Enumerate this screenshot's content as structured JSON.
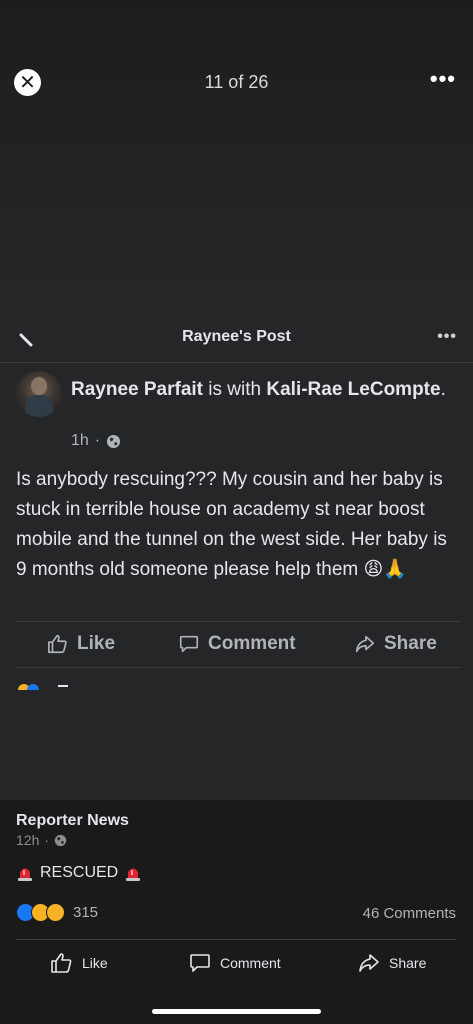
{
  "viewer": {
    "counter": "11 of 26",
    "close_icon": "✕",
    "more_icon": "•••"
  },
  "post_header": {
    "title": "Raynee's Post",
    "more_icon": "•••"
  },
  "post": {
    "author": "Raynee Parfait",
    "with_text": "is with",
    "tagged": "Kali-Rae LeCompte",
    "period": ".",
    "time": "1h",
    "dot": "·",
    "text": "Is anybody rescuing??? My cousin and her baby is stuck in terrible house on academy st near boost mobile and the tunnel on the west side. Her baby is 9 months old someone please help them",
    "emoji": "😩🙏"
  },
  "actions": {
    "like": "Like",
    "comment": "Comment",
    "share": "Share"
  },
  "reporter": {
    "name": "Reporter News",
    "time": "12h",
    "dot": "·",
    "text": "RESCUED",
    "reaction_count": "315",
    "comments": "46 Comments"
  },
  "bottom_actions": {
    "like": "Like",
    "comment": "Comment",
    "share": "Share"
  },
  "colors": {
    "background": "#252628",
    "bottom": "#1a1a1b",
    "text": "#e4e6eb",
    "muted": "#b0b3b8",
    "like_blue": "#1877f2"
  }
}
